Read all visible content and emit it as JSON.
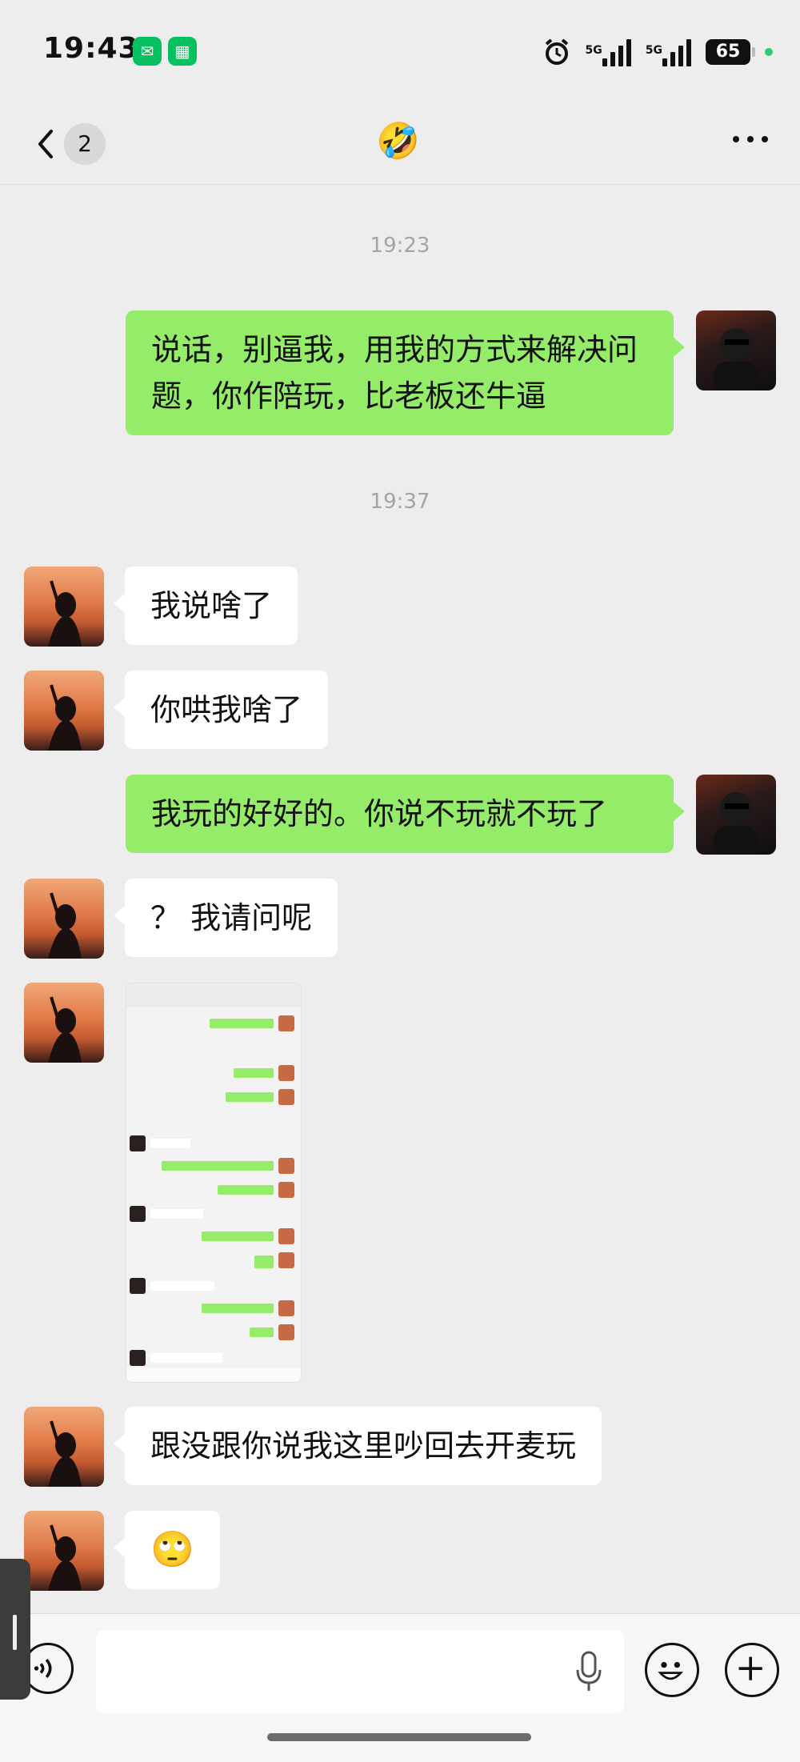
{
  "status_bar": {
    "time": "19:43",
    "sig1_label": "5G",
    "sig2_label": "5G",
    "battery": "65",
    "apps": [
      "wechat-icon",
      "app-icon"
    ]
  },
  "nav": {
    "back_count": "2",
    "title": "🤣",
    "more_label": "more-icon"
  },
  "messages": [
    {
      "type": "time",
      "text": "19:23"
    },
    {
      "type": "out",
      "text": "说话，别逼我，用我的方式来解决问题，你作陪玩，比老板还牛逼"
    },
    {
      "type": "time",
      "text": "19:37"
    },
    {
      "type": "in",
      "text": "我说啥了"
    },
    {
      "type": "in",
      "text": "你哄我啥了"
    },
    {
      "type": "out",
      "text": "我玩的好好的。你说不玩就不玩了"
    },
    {
      "type": "in",
      "text": "？ 我请问呢"
    },
    {
      "type": "in-image",
      "text": ""
    },
    {
      "type": "in",
      "text": "跟没跟你说我这里吵回去开麦玩"
    },
    {
      "type": "in",
      "text": "🙄"
    }
  ],
  "colors": {
    "bg": "#ededed",
    "out_bubble": "#95ec69",
    "in_bubble": "#ffffff",
    "timestamp": "#a4a4a4"
  }
}
